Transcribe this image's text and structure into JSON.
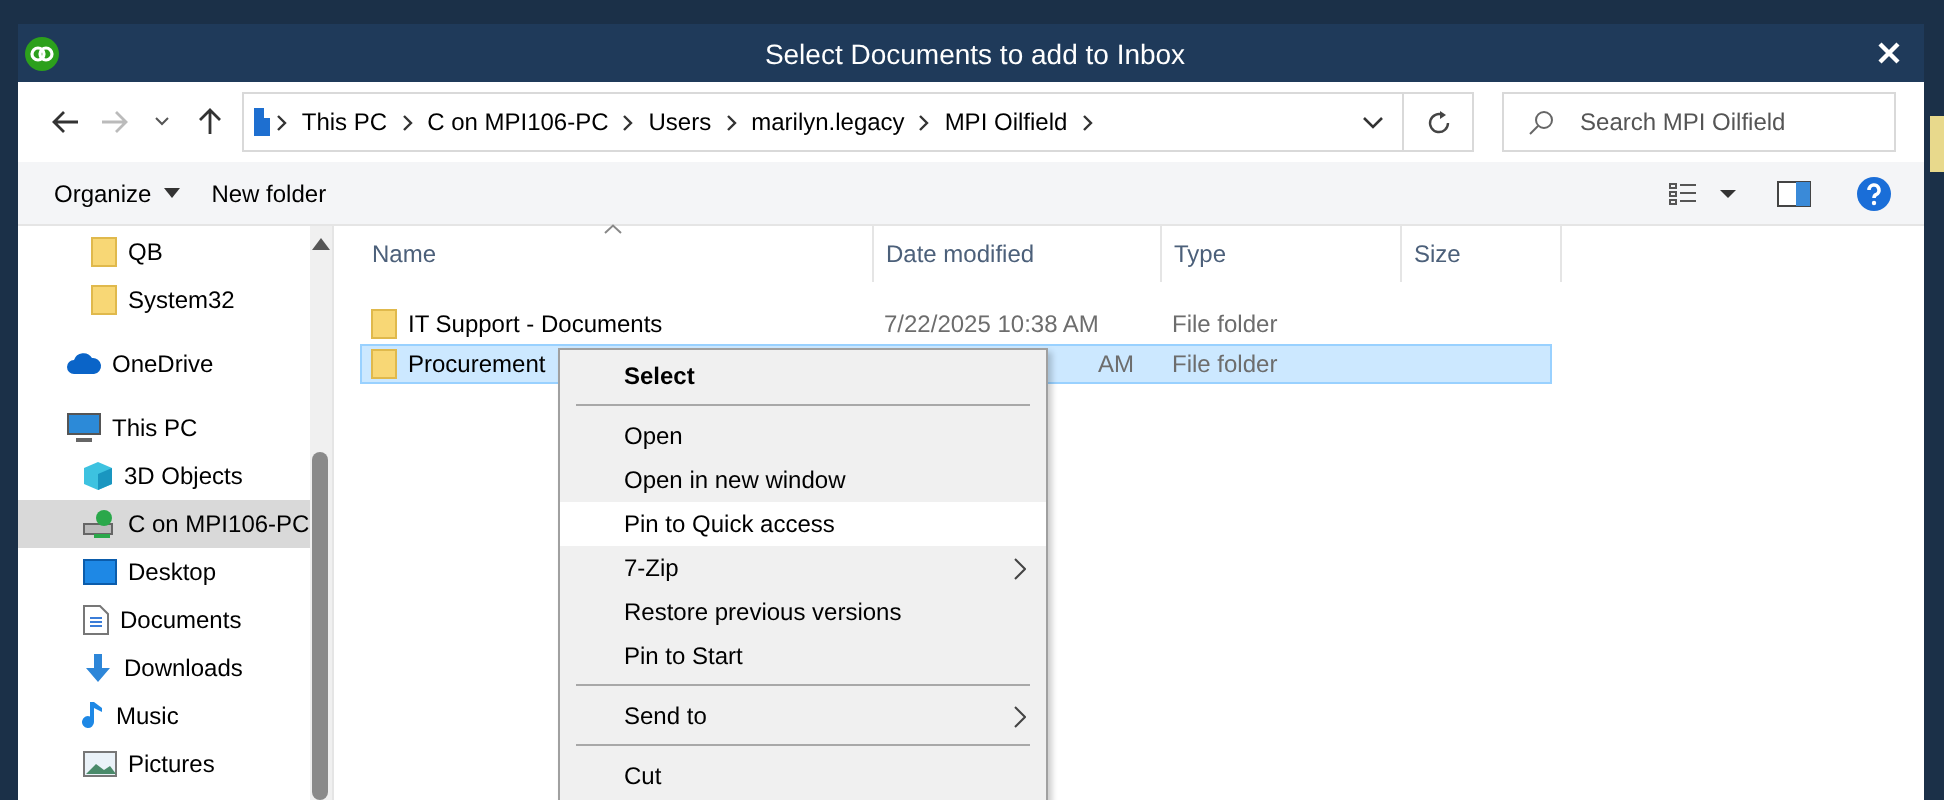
{
  "window": {
    "title": "Select Documents to add to Inbox"
  },
  "address": {
    "crumbs": [
      "This PC",
      "C on MPI106-PC",
      "Users",
      "marilyn.legacy",
      "MPI Oilfield"
    ]
  },
  "search": {
    "placeholder": "Search MPI Oilfield"
  },
  "toolbar": {
    "organize": "Organize",
    "new_folder": "New folder"
  },
  "nav": {
    "partial_children": [
      {
        "label": "QB",
        "kind": "folder",
        "selected": false
      },
      {
        "label": "System32",
        "kind": "folder",
        "selected": false
      }
    ],
    "items": [
      {
        "label": "OneDrive",
        "kind": "cloud",
        "selected": false
      },
      {
        "label": "This PC",
        "kind": "pc",
        "selected": false,
        "children": [
          {
            "label": "3D Objects",
            "kind": "cube",
            "selected": false
          },
          {
            "label": "C on MPI106-PC",
            "kind": "netdrive",
            "selected": true
          },
          {
            "label": "Desktop",
            "kind": "desktop",
            "selected": false
          },
          {
            "label": "Documents",
            "kind": "document",
            "selected": false
          },
          {
            "label": "Downloads",
            "kind": "download",
            "selected": false
          },
          {
            "label": "Music",
            "kind": "music",
            "selected": false
          },
          {
            "label": "Pictures",
            "kind": "picture",
            "selected": false
          }
        ]
      }
    ]
  },
  "files": {
    "columns": [
      "Name",
      "Date modified",
      "Type",
      "Size"
    ],
    "rows": [
      {
        "name": "IT Support - Documents",
        "date": "7/22/2025 10:38 AM",
        "type": "File folder",
        "selected": false
      },
      {
        "name": "Procurement",
        "date": "AM",
        "type": "File folder",
        "selected": true
      }
    ]
  },
  "context_menu": {
    "items": [
      {
        "kind": "default",
        "label": "Select",
        "hovered": false
      },
      {
        "kind": "separator"
      },
      {
        "kind": "item",
        "label": "Open",
        "hovered": false
      },
      {
        "kind": "item",
        "label": "Open in new window",
        "hovered": false
      },
      {
        "kind": "item",
        "label": "Pin to Quick access",
        "hovered": true
      },
      {
        "kind": "submenu",
        "label": "7-Zip",
        "hovered": false
      },
      {
        "kind": "item",
        "label": "Restore previous versions",
        "hovered": false
      },
      {
        "kind": "item",
        "label": "Pin to Start",
        "hovered": false
      },
      {
        "kind": "separator"
      },
      {
        "kind": "submenu",
        "label": "Send to",
        "hovered": false
      },
      {
        "kind": "separator"
      },
      {
        "kind": "item",
        "label": "Cut",
        "hovered": false
      }
    ]
  }
}
